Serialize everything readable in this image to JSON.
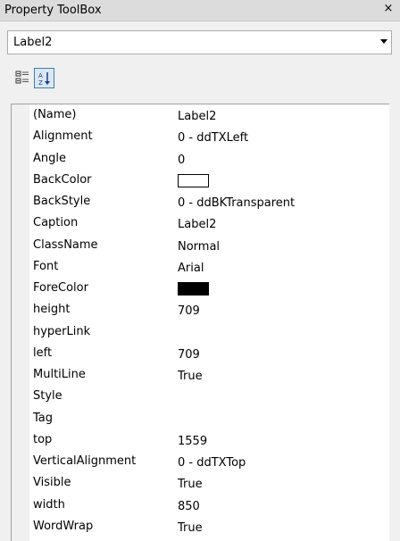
{
  "window": {
    "title": "Property ToolBox",
    "close_glyph": "×"
  },
  "object_selector": {
    "selected": "Label2"
  },
  "toolbar": {
    "buttons": [
      {
        "name": "categorized-icon",
        "pressed": false
      },
      {
        "name": "alphabetical-sort-icon",
        "pressed": true
      }
    ]
  },
  "properties": [
    {
      "name": "(Name)",
      "value": "Label2"
    },
    {
      "name": "Alignment",
      "value": "0 - ddTXLeft"
    },
    {
      "name": "Angle",
      "value": "0"
    },
    {
      "name": "BackColor",
      "value": "",
      "swatch": "#ffffff"
    },
    {
      "name": "BackStyle",
      "value": "0 - ddBKTransparent"
    },
    {
      "name": "Caption",
      "value": "Label2"
    },
    {
      "name": "ClassName",
      "value": "Normal"
    },
    {
      "name": "Font",
      "value": "Arial"
    },
    {
      "name": "ForeColor",
      "value": "",
      "swatch": "#000000"
    },
    {
      "name": "height",
      "value": "709"
    },
    {
      "name": "hyperLink",
      "value": ""
    },
    {
      "name": "left",
      "value": "709"
    },
    {
      "name": "MultiLine",
      "value": "True"
    },
    {
      "name": "Style",
      "value": ""
    },
    {
      "name": "Tag",
      "value": ""
    },
    {
      "name": "top",
      "value": "1559"
    },
    {
      "name": "VerticalAlignment",
      "value": "0 - ddTXTop"
    },
    {
      "name": "Visible",
      "value": "True"
    },
    {
      "name": "width",
      "value": "850"
    },
    {
      "name": "WordWrap",
      "value": "True"
    }
  ]
}
